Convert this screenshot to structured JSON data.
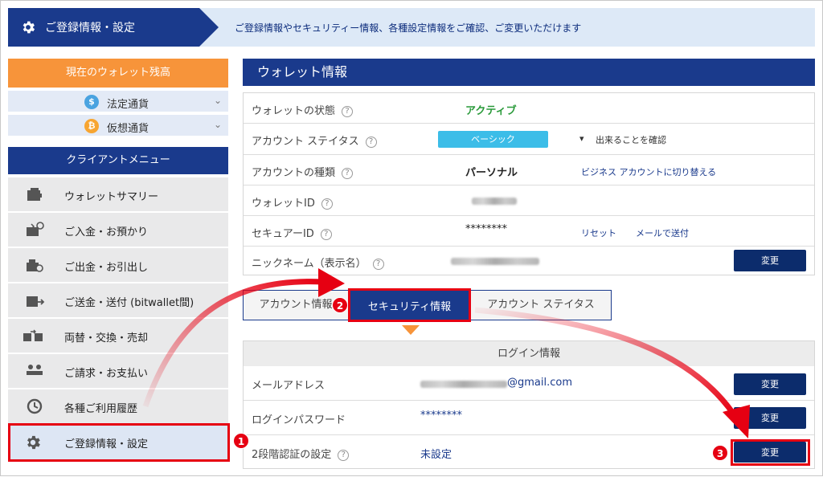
{
  "header": {
    "title": "ご登録情報・設定",
    "description": "ご登録情報やセキュリティー情報、各種設定情報をご確認、ご変更いただけます"
  },
  "sidebar": {
    "wallet_balance_title": "現在のウォレット残高",
    "currencies": [
      {
        "label": "法定通貨",
        "icon": "dollar-coin-icon",
        "symbol": "$",
        "color": "#4aa3e0"
      },
      {
        "label": "仮想通貨",
        "icon": "bitcoin-coin-icon",
        "symbol": "₿",
        "color": "#f7a531"
      }
    ],
    "menu_title": "クライアントメニュー",
    "items": [
      {
        "label": "ウォレットサマリー",
        "icon": "wallet-icon"
      },
      {
        "label": "ご入金・お預かり",
        "icon": "deposit-icon"
      },
      {
        "label": "ご出金・お引出し",
        "icon": "withdraw-icon"
      },
      {
        "label": "ご送金・送付 (bitwallet間)",
        "icon": "transfer-icon"
      },
      {
        "label": "両替・交換・売却",
        "icon": "exchange-icon"
      },
      {
        "label": "ご請求・お支払い",
        "icon": "invoice-icon"
      },
      {
        "label": "各種ご利用履歴",
        "icon": "history-icon"
      },
      {
        "label": "ご登録情報・設定",
        "icon": "gear-icon"
      }
    ]
  },
  "wallet_info": {
    "title": "ウォレット情報",
    "status_label": "ウォレットの状態",
    "status_value": "アクティブ",
    "account_status_label": "アカウント ステイタス",
    "account_status_badge": "ベーシック",
    "account_status_link": "出来ることを確認",
    "account_type_label": "アカウントの種類",
    "account_type_value": "パーソナル",
    "account_type_link": "ビジネス アカウントに切り替える",
    "wallet_id_label": "ウォレットID",
    "secure_id_label": "セキュアーID",
    "secure_id_value": "********",
    "secure_id_reset": "リセット",
    "secure_id_mail": "メールで送付",
    "nickname_label": "ニックネーム（表示名）",
    "change_label": "変更"
  },
  "tabs": [
    {
      "label": "アカウント情報"
    },
    {
      "label": "セキュリティ情報"
    },
    {
      "label": "アカウント ステイタス"
    }
  ],
  "login_info": {
    "title": "ログイン情報",
    "email_label": "メールアドレス",
    "email_domain": "@gmail.com",
    "password_label": "ログインパスワード",
    "password_value": "********",
    "twofa_label": "2段階認証の設定",
    "twofa_value": "未設定",
    "change_label": "変更"
  },
  "annotations": {
    "step1": "1",
    "step2": "2",
    "step3": "3",
    "color": "#e60012"
  },
  "colors": {
    "navy": "#1a3a8c",
    "orange": "#f7943a",
    "active_green": "#2a9a3a",
    "badge_cyan": "#3cbde8"
  }
}
